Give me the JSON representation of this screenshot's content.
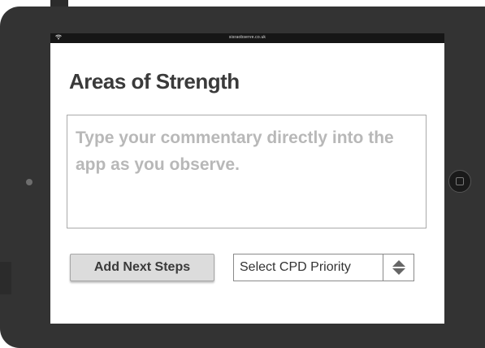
{
  "status_bar": {
    "url": "sisraobserve.co.uk",
    "wifi_icon": "wifi-icon"
  },
  "page": {
    "title": "Areas of Strength"
  },
  "commentary": {
    "placeholder": "Type your commentary directly into the app as you observe.",
    "value": ""
  },
  "actions": {
    "next_steps_label": "Add Next Steps"
  },
  "cpd_select": {
    "selected": "Select CPD Priority",
    "arrows_icon": "up-down-arrows-icon"
  },
  "colors": {
    "bezel": "#333333",
    "title": "#3a3a3a",
    "placeholder": "#b8b8b8",
    "button": "#dcdcdc"
  }
}
